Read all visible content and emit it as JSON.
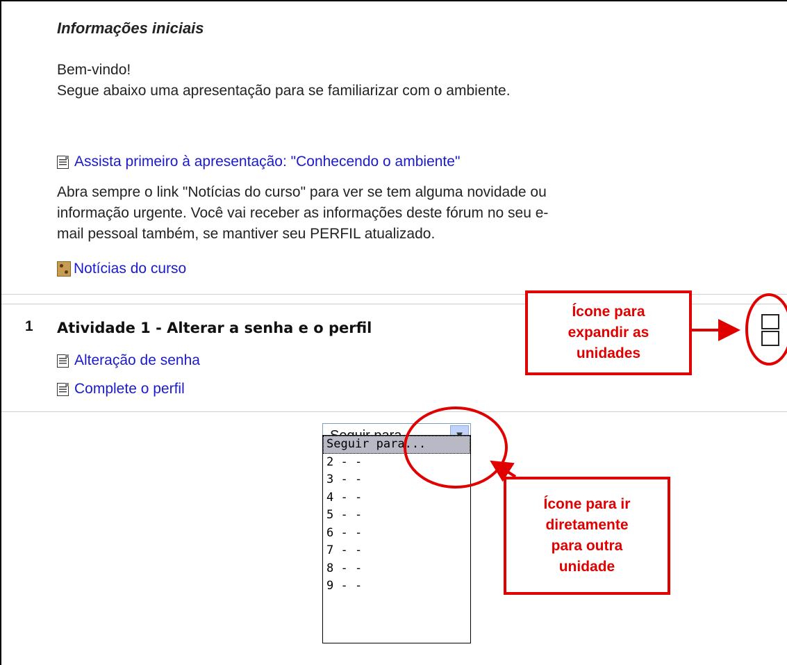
{
  "section0": {
    "title": "Informações iniciais",
    "welcome": "Bem-vindo!",
    "intro": "Segue abaixo uma apresentação para se familiarizar com o ambiente.",
    "presentation_link": "Assista primeiro à apresentação: \"Conhecendo o ambiente\"",
    "notice_line1": "Abra sempre o link \"Notícias do curso\" para ver se tem alguma novidade ou",
    "notice_line2": "informação urgente. Você vai receber as informações deste fórum no seu e-",
    "notice_line3": "mail pessoal também, se mantiver seu PERFIL atualizado.",
    "news_link": "Notícias do curso"
  },
  "section1": {
    "number": "1",
    "title": "Atividade 1 - Alterar a senha e o perfil",
    "links": [
      "Alteração de senha",
      "Complete o perfil"
    ]
  },
  "jump": {
    "selected": "Seguir para...",
    "options": [
      "Seguir para...",
      "2 - -",
      "3 - -",
      "4 - -",
      "5 - -",
      "6 - -",
      "7 - -",
      "8 - -",
      "9 - -"
    ]
  },
  "annotations": {
    "expand_line1": "Ícone para",
    "expand_line2": "expandir as",
    "expand_line3": "unidades",
    "jump_line1": "Ícone para ir",
    "jump_line2": "diretamente",
    "jump_line3": "para outra",
    "jump_line4": "unidade"
  },
  "colors": {
    "link": "#1a1acc",
    "annotation": "#e00000"
  }
}
